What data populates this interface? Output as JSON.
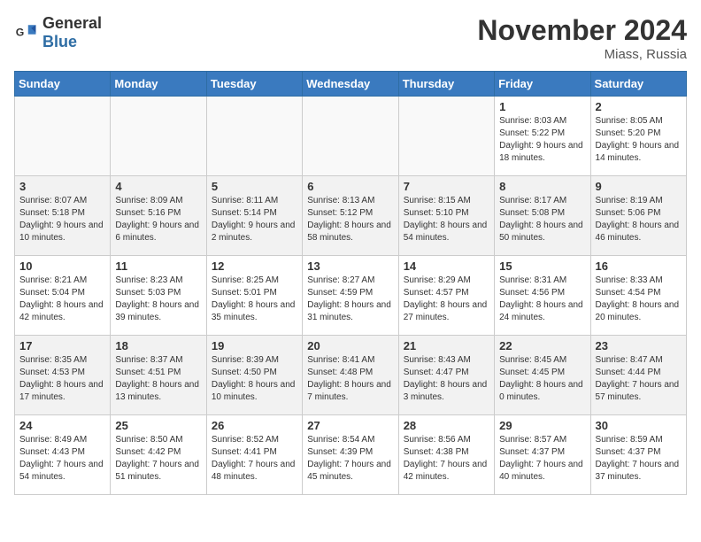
{
  "header": {
    "logo_general": "General",
    "logo_blue": "Blue",
    "month_title": "November 2024",
    "location": "Miass, Russia"
  },
  "days_of_week": [
    "Sunday",
    "Monday",
    "Tuesday",
    "Wednesday",
    "Thursday",
    "Friday",
    "Saturday"
  ],
  "weeks": [
    [
      {
        "day": "",
        "info": ""
      },
      {
        "day": "",
        "info": ""
      },
      {
        "day": "",
        "info": ""
      },
      {
        "day": "",
        "info": ""
      },
      {
        "day": "",
        "info": ""
      },
      {
        "day": "1",
        "info": "Sunrise: 8:03 AM\nSunset: 5:22 PM\nDaylight: 9 hours\nand 18 minutes."
      },
      {
        "day": "2",
        "info": "Sunrise: 8:05 AM\nSunset: 5:20 PM\nDaylight: 9 hours\nand 14 minutes."
      }
    ],
    [
      {
        "day": "3",
        "info": "Sunrise: 8:07 AM\nSunset: 5:18 PM\nDaylight: 9 hours\nand 10 minutes."
      },
      {
        "day": "4",
        "info": "Sunrise: 8:09 AM\nSunset: 5:16 PM\nDaylight: 9 hours\nand 6 minutes."
      },
      {
        "day": "5",
        "info": "Sunrise: 8:11 AM\nSunset: 5:14 PM\nDaylight: 9 hours\nand 2 minutes."
      },
      {
        "day": "6",
        "info": "Sunrise: 8:13 AM\nSunset: 5:12 PM\nDaylight: 8 hours\nand 58 minutes."
      },
      {
        "day": "7",
        "info": "Sunrise: 8:15 AM\nSunset: 5:10 PM\nDaylight: 8 hours\nand 54 minutes."
      },
      {
        "day": "8",
        "info": "Sunrise: 8:17 AM\nSunset: 5:08 PM\nDaylight: 8 hours\nand 50 minutes."
      },
      {
        "day": "9",
        "info": "Sunrise: 8:19 AM\nSunset: 5:06 PM\nDaylight: 8 hours\nand 46 minutes."
      }
    ],
    [
      {
        "day": "10",
        "info": "Sunrise: 8:21 AM\nSunset: 5:04 PM\nDaylight: 8 hours\nand 42 minutes."
      },
      {
        "day": "11",
        "info": "Sunrise: 8:23 AM\nSunset: 5:03 PM\nDaylight: 8 hours\nand 39 minutes."
      },
      {
        "day": "12",
        "info": "Sunrise: 8:25 AM\nSunset: 5:01 PM\nDaylight: 8 hours\nand 35 minutes."
      },
      {
        "day": "13",
        "info": "Sunrise: 8:27 AM\nSunset: 4:59 PM\nDaylight: 8 hours\nand 31 minutes."
      },
      {
        "day": "14",
        "info": "Sunrise: 8:29 AM\nSunset: 4:57 PM\nDaylight: 8 hours\nand 27 minutes."
      },
      {
        "day": "15",
        "info": "Sunrise: 8:31 AM\nSunset: 4:56 PM\nDaylight: 8 hours\nand 24 minutes."
      },
      {
        "day": "16",
        "info": "Sunrise: 8:33 AM\nSunset: 4:54 PM\nDaylight: 8 hours\nand 20 minutes."
      }
    ],
    [
      {
        "day": "17",
        "info": "Sunrise: 8:35 AM\nSunset: 4:53 PM\nDaylight: 8 hours\nand 17 minutes."
      },
      {
        "day": "18",
        "info": "Sunrise: 8:37 AM\nSunset: 4:51 PM\nDaylight: 8 hours\nand 13 minutes."
      },
      {
        "day": "19",
        "info": "Sunrise: 8:39 AM\nSunset: 4:50 PM\nDaylight: 8 hours\nand 10 minutes."
      },
      {
        "day": "20",
        "info": "Sunrise: 8:41 AM\nSunset: 4:48 PM\nDaylight: 8 hours\nand 7 minutes."
      },
      {
        "day": "21",
        "info": "Sunrise: 8:43 AM\nSunset: 4:47 PM\nDaylight: 8 hours\nand 3 minutes."
      },
      {
        "day": "22",
        "info": "Sunrise: 8:45 AM\nSunset: 4:45 PM\nDaylight: 8 hours\nand 0 minutes."
      },
      {
        "day": "23",
        "info": "Sunrise: 8:47 AM\nSunset: 4:44 PM\nDaylight: 7 hours\nand 57 minutes."
      }
    ],
    [
      {
        "day": "24",
        "info": "Sunrise: 8:49 AM\nSunset: 4:43 PM\nDaylight: 7 hours\nand 54 minutes."
      },
      {
        "day": "25",
        "info": "Sunrise: 8:50 AM\nSunset: 4:42 PM\nDaylight: 7 hours\nand 51 minutes."
      },
      {
        "day": "26",
        "info": "Sunrise: 8:52 AM\nSunset: 4:41 PM\nDaylight: 7 hours\nand 48 minutes."
      },
      {
        "day": "27",
        "info": "Sunrise: 8:54 AM\nSunset: 4:39 PM\nDaylight: 7 hours\nand 45 minutes."
      },
      {
        "day": "28",
        "info": "Sunrise: 8:56 AM\nSunset: 4:38 PM\nDaylight: 7 hours\nand 42 minutes."
      },
      {
        "day": "29",
        "info": "Sunrise: 8:57 AM\nSunset: 4:37 PM\nDaylight: 7 hours\nand 40 minutes."
      },
      {
        "day": "30",
        "info": "Sunrise: 8:59 AM\nSunset: 4:37 PM\nDaylight: 7 hours\nand 37 minutes."
      }
    ]
  ]
}
